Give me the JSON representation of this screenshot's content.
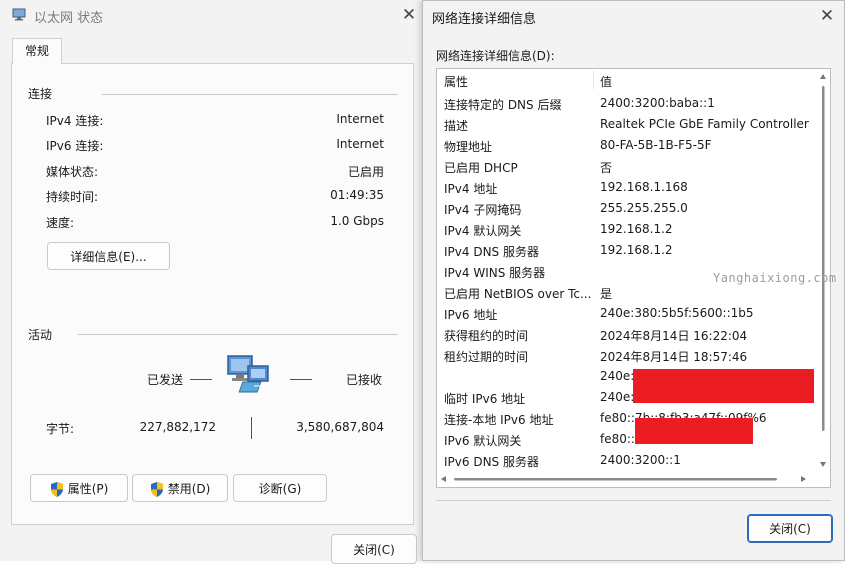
{
  "status_window": {
    "title": "以太网 状态",
    "tab": "常规",
    "connection_section": "连接",
    "rows": [
      {
        "label": "IPv4 连接:",
        "value": "Internet"
      },
      {
        "label": "IPv6 连接:",
        "value": "Internet"
      },
      {
        "label": "媒体状态:",
        "value": "已启用"
      },
      {
        "label": "持续时间:",
        "value": "01:49:35"
      },
      {
        "label": "速度:",
        "value": "1.0 Gbps"
      }
    ],
    "details_button": "详细信息(E)...",
    "activity_section": "活动",
    "sent_label": "已发送",
    "received_label": "已接收",
    "bytes_label": "字节:",
    "bytes_sent": "227,882,172",
    "bytes_received": "3,580,687,804",
    "properties_button": "属性(P)",
    "disable_button": "禁用(D)",
    "diagnose_button": "诊断(G)",
    "close_button": "关闭(C)"
  },
  "details_window": {
    "title": "网络连接详细信息",
    "list_label": "网络连接详细信息(D):",
    "col_property": "属性",
    "col_value": "值",
    "rows": [
      {
        "property": "连接特定的 DNS 后缀",
        "value": "2400:3200:baba::1"
      },
      {
        "property": "描述",
        "value": "Realtek PCIe GbE Family Controller"
      },
      {
        "property": "物理地址",
        "value": "80-FA-5B-1B-F5-5F"
      },
      {
        "property": "已启用 DHCP",
        "value": "否"
      },
      {
        "property": "IPv4 地址",
        "value": "192.168.1.168"
      },
      {
        "property": "IPv4 子网掩码",
        "value": "255.255.255.0"
      },
      {
        "property": "IPv4 默认网关",
        "value": "192.168.1.2"
      },
      {
        "property": "IPv4 DNS 服务器",
        "value": "192.168.1.2"
      },
      {
        "property": "IPv4 WINS 服务器",
        "value": ""
      },
      {
        "property": "已启用 NetBIOS over Tc...",
        "value": "是"
      },
      {
        "property": "IPv6 地址",
        "value": "240e:380:5b5f:5600::1b5"
      },
      {
        "property": "获得租约的时间",
        "value": "2024年8月14日 16:22:04"
      },
      {
        "property": "租约过期的时间",
        "value": "2024年8月14日 18:57:46"
      },
      {
        "property": "",
        "value": "240e:3"
      },
      {
        "property": "临时 IPv6 地址",
        "value": "240e:3"
      },
      {
        "property": "连接-本地 IPv6 地址",
        "value": "fe80::7b::8:fb3:a47f::09f%6"
      },
      {
        "property": "IPv6 默认网关",
        "value": "fe80::a                          %6"
      },
      {
        "property": "IPv6 DNS 服务器",
        "value": "2400:3200::1"
      }
    ],
    "close_button": "关闭(C)"
  },
  "watermark": "Yanghaixiong.com",
  "colors": {
    "redaction": "#ec1c24",
    "accent": "#2d6bbd"
  }
}
